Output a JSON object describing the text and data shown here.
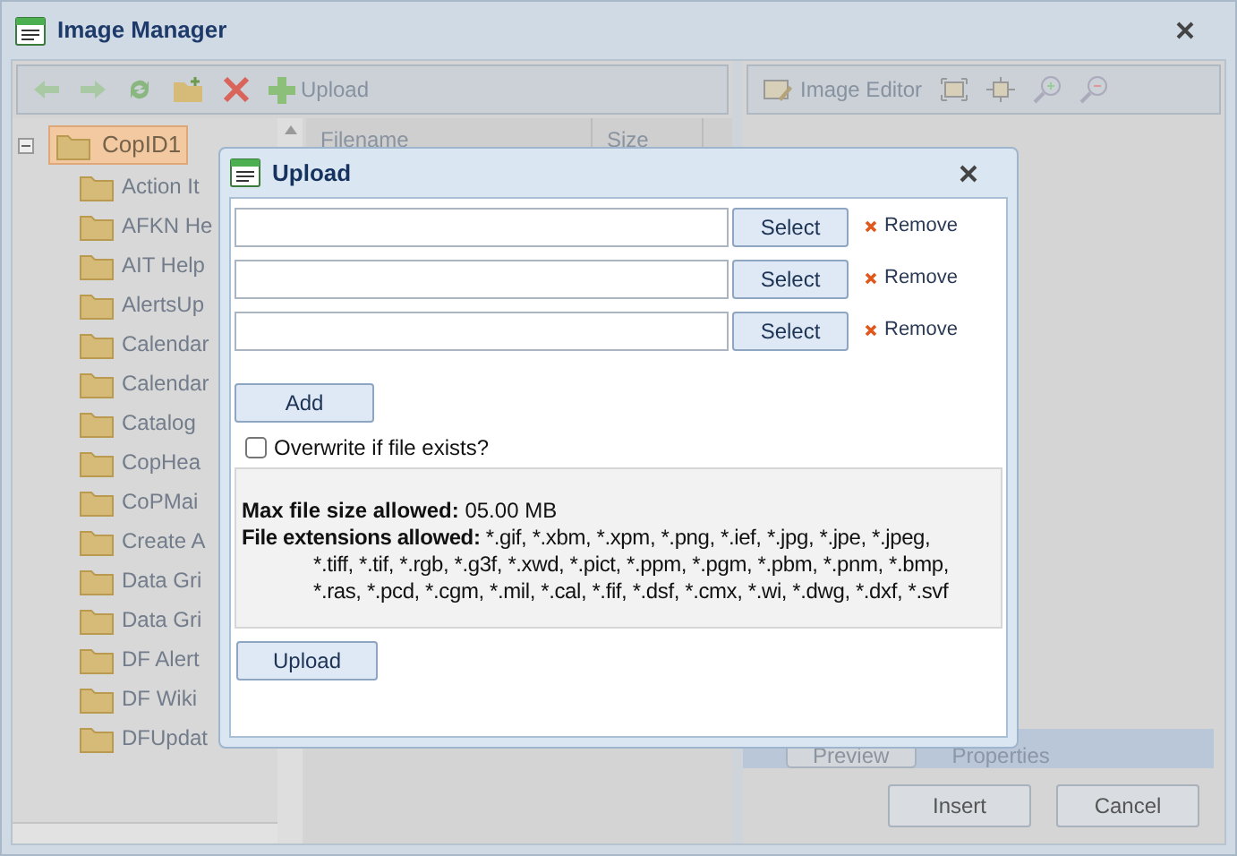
{
  "window": {
    "title": "Image Manager"
  },
  "toolbar": {
    "upload_label": "Upload"
  },
  "editor_toolbar": {
    "label": "Image Editor"
  },
  "tree": {
    "label": "CopID1",
    "selected": true,
    "expanded": true,
    "children": [
      {
        "label": "Action It"
      },
      {
        "label": "AFKN He"
      },
      {
        "label": "AIT Help"
      },
      {
        "label": "AlertsUp"
      },
      {
        "label": "Calendar"
      },
      {
        "label": "Calendar"
      },
      {
        "label": "Catalog"
      },
      {
        "label": "CopHea"
      },
      {
        "label": "CoPMai"
      },
      {
        "label": "Create A"
      },
      {
        "label": "Data Gri"
      },
      {
        "label": "Data Gri"
      },
      {
        "label": "DF Alert"
      },
      {
        "label": "DF Wiki"
      },
      {
        "label": "DFUpdat"
      }
    ]
  },
  "grid": {
    "columns": [
      "Filename",
      "Size"
    ]
  },
  "tabs": [
    {
      "label": "Preview",
      "selected": true
    },
    {
      "label": "Properties",
      "selected": false
    }
  ],
  "buttons": [
    "Insert",
    "Cancel"
  ],
  "dialog": {
    "title": "Upload",
    "files": [
      {
        "select_label": "Select",
        "remove_label": "Remove"
      },
      {
        "select_label": "Select",
        "remove_label": "Remove"
      },
      {
        "select_label": "Select",
        "remove_label": "Remove"
      }
    ],
    "add_label": "Add",
    "overwrite": {
      "label": "Overwrite if file exists?",
      "checked": false
    },
    "info": [
      "**Max file size allowed:** 05.00 MB",
      "**File extensions allowed:** *.gif, *.xbm, *.xpm, *.png, *.ief, *.jpg, *.jpe, *.jpeg, *.tiff, *.tif, *.rgb, *.g3f, *.xwd, *.pict, *.ppm, *.pgm, *.pbm, *.pnm, *.bmp, *.ras, *.pcd, *.cgm, *.mil, *.cal, *.fif, *.dsf, *.cmx, *.wi, *.dwg, *.dxf, *.svf"
    ],
    "upload_label": "Upload"
  }
}
